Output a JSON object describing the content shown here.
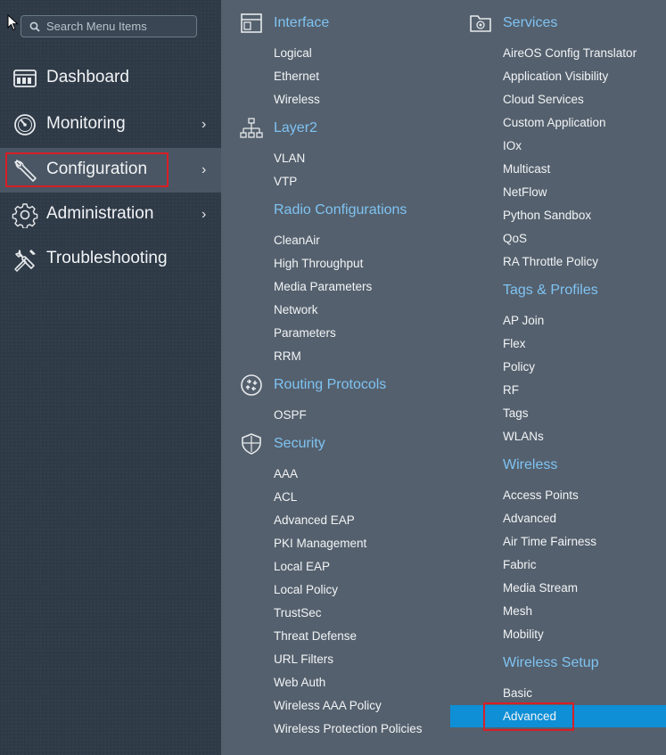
{
  "sidebar": {
    "search_placeholder": "Search Menu Items",
    "items": [
      {
        "label": "Dashboard",
        "icon": "dashboard-icon"
      },
      {
        "label": "Monitoring",
        "icon": "gauge-icon",
        "chevron": "›"
      },
      {
        "label": "Configuration",
        "icon": "wrench-icon",
        "chevron": "›",
        "active": true
      },
      {
        "label": "Administration",
        "icon": "gear-icon",
        "chevron": "›"
      },
      {
        "label": "Troubleshooting",
        "icon": "tools-icon"
      }
    ]
  },
  "menu": {
    "col1": [
      {
        "title": "Interface",
        "icon": "interface-icon",
        "items": [
          "Logical",
          "Ethernet",
          "Wireless"
        ]
      },
      {
        "title": "Layer2",
        "icon": "network-tree-icon",
        "items": [
          "VLAN",
          "VTP"
        ]
      },
      {
        "title": "Radio Configurations",
        "items": [
          "CleanAir",
          "High Throughput",
          "Media Parameters",
          "Network",
          "Parameters",
          "RRM"
        ]
      },
      {
        "title": "Routing Protocols",
        "icon": "router-icon",
        "items": [
          "OSPF"
        ]
      },
      {
        "title": "Security",
        "icon": "shield-icon",
        "items": [
          "AAA",
          "ACL",
          "Advanced EAP",
          "PKI Management",
          "Local EAP",
          "Local Policy",
          "TrustSec",
          "Threat Defense",
          "URL Filters",
          "Web Auth",
          "Wireless AAA Policy",
          "Wireless Protection Policies"
        ]
      }
    ],
    "col2": [
      {
        "title": "Services",
        "icon": "services-icon",
        "items": [
          "AireOS Config Translator",
          "Application Visibility",
          "Cloud Services",
          "Custom Application",
          "IOx",
          "Multicast",
          "NetFlow",
          "Python Sandbox",
          "QoS",
          "RA Throttle Policy"
        ]
      },
      {
        "title": "Tags & Profiles",
        "items": [
          "AP Join",
          "Flex",
          "Policy",
          "RF",
          "Tags",
          "WLANs"
        ]
      },
      {
        "title": "Wireless",
        "items": [
          "Access Points",
          "Advanced",
          "Air Time Fairness",
          "Fabric",
          "Media Stream",
          "Mesh",
          "Mobility"
        ]
      },
      {
        "title": "Wireless Setup",
        "items": [
          "Basic",
          "Advanced"
        ]
      }
    ]
  },
  "colors": {
    "sidebar_bg": "#2f3a47",
    "menu_bg": "#54606d",
    "category_title": "#7fc3f3",
    "highlight": "#0e8fd6",
    "annotation_box": "#d71f26"
  }
}
